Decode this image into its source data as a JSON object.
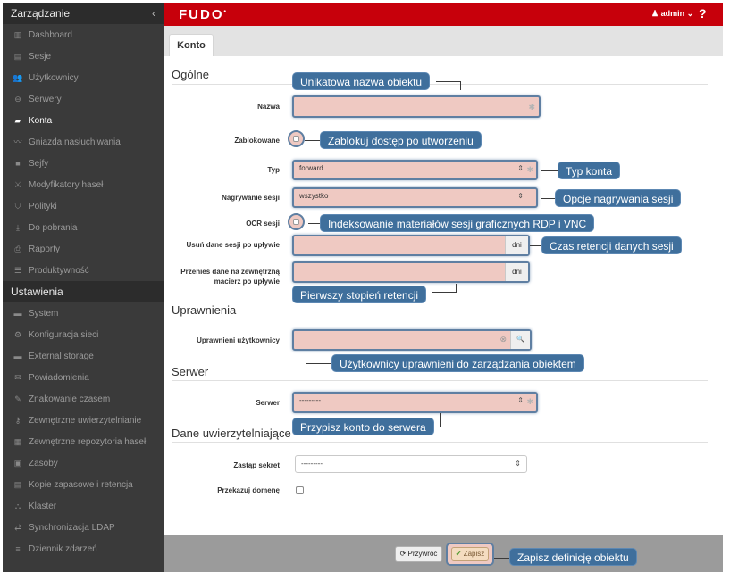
{
  "sidebar": {
    "section_management": "Zarządzanie",
    "collapse_glyph": "‹",
    "management_items": [
      {
        "label": "Dashboard",
        "icon": "▥"
      },
      {
        "label": "Sesje",
        "icon": "▤"
      },
      {
        "label": "Użytkownicy",
        "icon": "👥"
      },
      {
        "label": "Serwery",
        "icon": "⊖"
      },
      {
        "label": "Konta",
        "icon": "▰"
      },
      {
        "label": "Gniazda nasłuchiwania",
        "icon": "〰"
      },
      {
        "label": "Sejfy",
        "icon": "■"
      },
      {
        "label": "Modyfikatory haseł",
        "icon": "⚔"
      },
      {
        "label": "Polityki",
        "icon": "⛉"
      },
      {
        "label": "Do pobrania",
        "icon": "⤓"
      },
      {
        "label": "Raporty",
        "icon": "⎙"
      },
      {
        "label": "Produktywność",
        "icon": "☰"
      }
    ],
    "active_index": 4,
    "section_settings": "Ustawienia",
    "settings_items": [
      {
        "label": "System",
        "icon": "▬"
      },
      {
        "label": "Konfiguracja sieci",
        "icon": "⚙"
      },
      {
        "label": "External storage",
        "icon": "▬"
      },
      {
        "label": "Powiadomienia",
        "icon": "✉"
      },
      {
        "label": "Znakowanie czasem",
        "icon": "✎"
      },
      {
        "label": "Zewnętrzne uwierzytelnianie",
        "icon": "⚷"
      },
      {
        "label": "Zewnętrzne repozytoria haseł",
        "icon": "▦"
      },
      {
        "label": "Zasoby",
        "icon": "▣"
      },
      {
        "label": "Kopie zapasowe i retencja",
        "icon": "▤"
      },
      {
        "label": "Klaster",
        "icon": "⛬"
      },
      {
        "label": "Synchronizacja LDAP",
        "icon": "⇄"
      },
      {
        "label": "Dziennik zdarzeń",
        "icon": "≡"
      }
    ]
  },
  "topbar": {
    "logo": "FUDO",
    "user_label": "admin",
    "user_caret": "⌄",
    "help": "?"
  },
  "tabs": {
    "konto": "Konto"
  },
  "sections": {
    "general": "Ogólne",
    "permissions": "Uprawnienia",
    "server": "Serwer",
    "credentials": "Dane uwierzytelniające"
  },
  "fields": {
    "nazwa": {
      "label": "Nazwa",
      "value": ""
    },
    "zablokowane": {
      "label": "Zablokowane",
      "checked": false
    },
    "typ": {
      "label": "Typ",
      "value": "forward"
    },
    "nagrywanie": {
      "label": "Nagrywanie sesji",
      "value": "wszystko"
    },
    "ocr": {
      "label": "OCR sesji",
      "checked": false
    },
    "usun": {
      "label": "Usuń dane sesji po upływie",
      "value": "",
      "unit": "dni"
    },
    "przenies": {
      "label": "Przenieś dane na zewnętrzną macierz po upływie",
      "value": "",
      "unit": "dni"
    },
    "uprawnieni": {
      "label": "Uprawnieni użytkownicy",
      "value": ""
    },
    "serwer": {
      "label": "Serwer",
      "value": "---------"
    },
    "sekret": {
      "label": "Zastąp sekret",
      "value": "---------"
    },
    "domena": {
      "label": "Przekazuj domenę",
      "checked": false
    }
  },
  "callouts": {
    "nazwa": "Unikatowa nazwa obiektu",
    "zablokowane": "Zablokuj dostęp po utworzeniu",
    "typ": "Typ konta",
    "nagrywanie": "Opcje nagrywania sesji",
    "ocr": "Indeksowanie materiałów sesji graficznych RDP i VNC",
    "usun": "Czas retencji danych sesji",
    "przenies": "Pierwszy stopień retencji",
    "uprawnieni": "Użytkownicy uprawnieni do zarządzania obiektem",
    "serwer": "Przypisz konto do serwera",
    "zapisz": "Zapisz definicję obiektu"
  },
  "footer": {
    "restore_label": "Przywróć",
    "save_label": "Zapisz"
  },
  "icons": {
    "required": "✱",
    "select_arrow": "⇕",
    "clear": "⊗",
    "search": "🔍",
    "restore": "⟳",
    "save": "✔",
    "user": "♟"
  },
  "colors": {
    "brand_red": "#c7000b",
    "sidebar_bg": "#3a3a3a",
    "callout_blue": "#3f6f9c",
    "highlight_fill": "#efc9c2"
  }
}
